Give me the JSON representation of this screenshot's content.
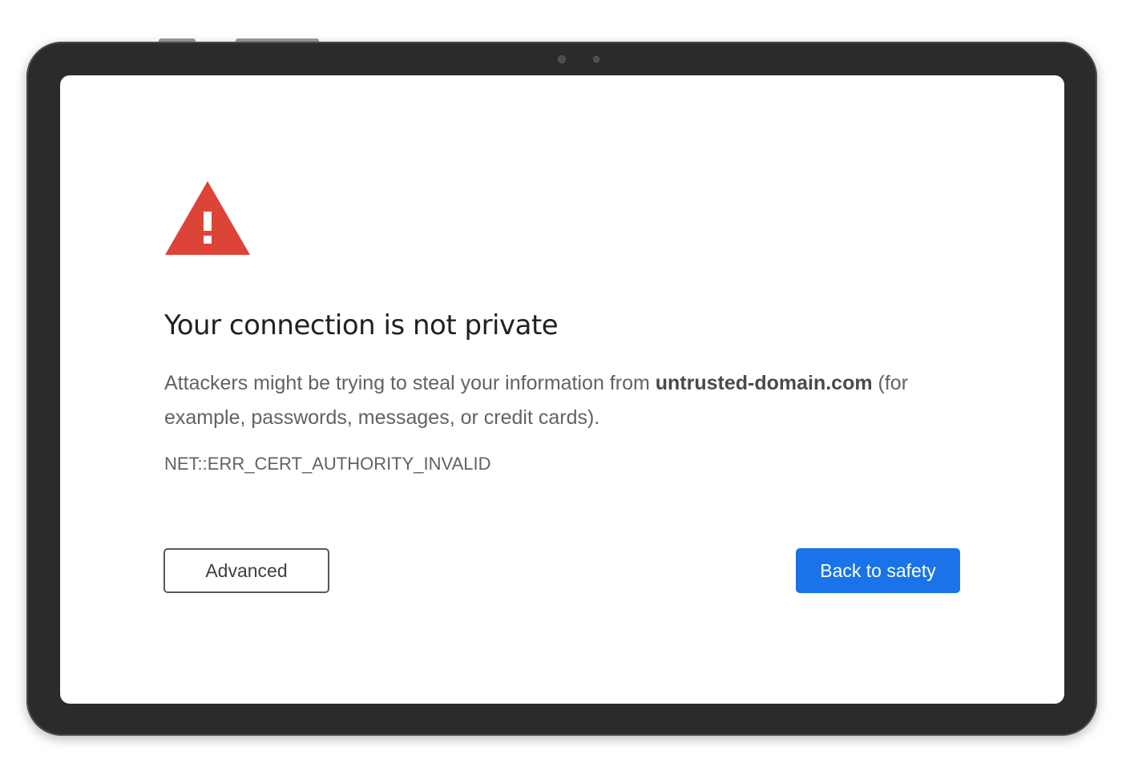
{
  "icons": {
    "warning": "warning-triangle-icon",
    "camera": "camera-icon"
  },
  "colors": {
    "warning_red": "#db4437",
    "primary_blue": "#1a73e8",
    "bezel": "#2b2b2b"
  },
  "interstitial": {
    "title": "Your connection is not private",
    "description_prefix": "Attackers might be trying to steal your information from ",
    "domain": "untrusted-domain.com",
    "description_suffix": " (for example, passwords, messages, or credit cards).",
    "error_code": "NET::ERR_CERT_AUTHORITY_INVALID",
    "advanced_label": "Advanced",
    "back_label": "Back to safety"
  }
}
